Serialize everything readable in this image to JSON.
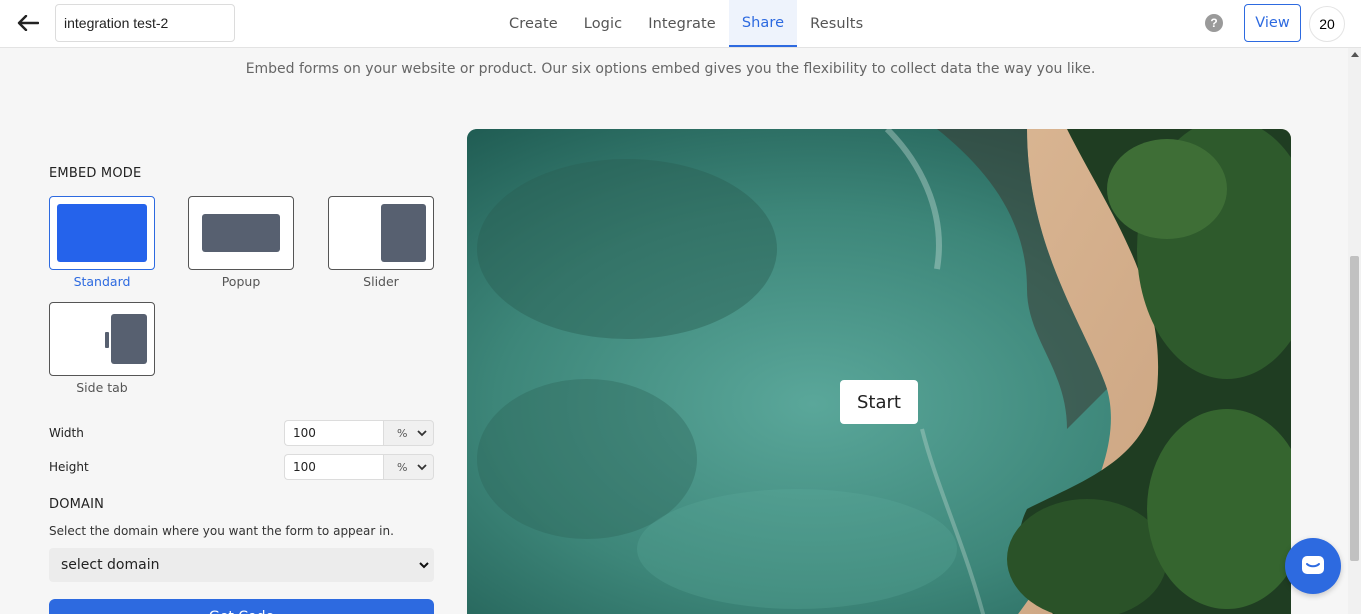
{
  "header": {
    "form_title": "integration test-2",
    "tabs": [
      {
        "label": "Create",
        "active": false
      },
      {
        "label": "Logic",
        "active": false
      },
      {
        "label": "Integrate",
        "active": false
      },
      {
        "label": "Share",
        "active": true
      },
      {
        "label": "Results",
        "active": false
      }
    ],
    "help_symbol": "?",
    "view_label": "View",
    "avatar_text": "20"
  },
  "subtitle": "Embed forms on your website or product. Our six options embed gives you the flexibility to collect data the way you like.",
  "embed_mode": {
    "heading": "EMBED MODE",
    "modes": [
      {
        "label": "Standard",
        "selected": true
      },
      {
        "label": "Popup",
        "selected": false
      },
      {
        "label": "Slider",
        "selected": false
      },
      {
        "label": "Side tab",
        "selected": false
      }
    ]
  },
  "dimensions": {
    "width_label": "Width",
    "width_value": "100",
    "width_unit": "%",
    "height_label": "Height",
    "height_value": "100",
    "height_unit": "%"
  },
  "domain": {
    "heading": "DOMAIN",
    "help_text": "Select the domain where you want the form to appear in.",
    "selected": "select domain"
  },
  "get_code_label": "Get Code",
  "preview": {
    "start_label": "Start"
  },
  "colors": {
    "accent": "#2d6ae0",
    "shape_gray": "#576070",
    "selected_fill": "#2563eb"
  },
  "icons": {
    "back": "arrow-left-icon",
    "help": "question-circle-icon",
    "chat": "chat-bubble-icon"
  }
}
